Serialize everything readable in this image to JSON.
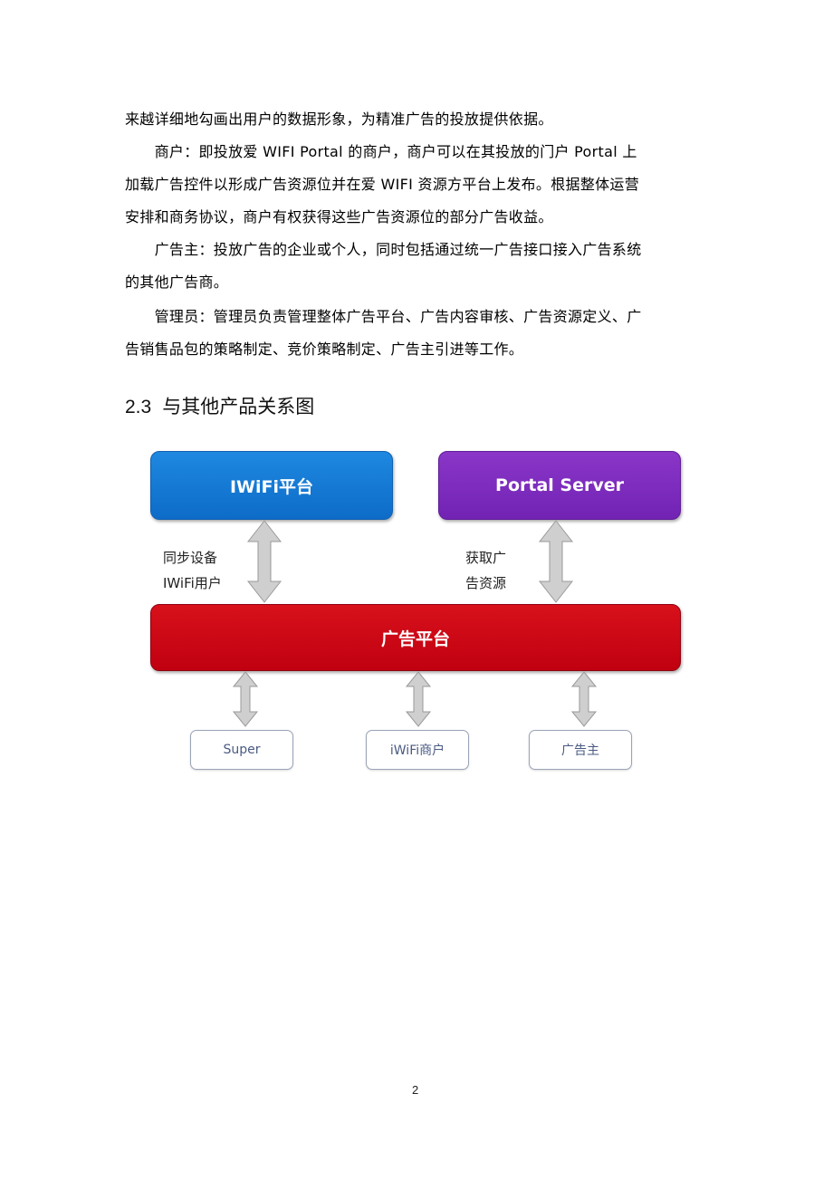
{
  "paragraphs": [
    "来越详细地勾画出用户的数据形象，为精准广告的投放提供依据。",
    "　　商户：即投放爱  WIFI Portal    的商户，商户可以在其投放的门户     Portal  上",
    "加载广告控件以形成广告资源位并在爱     WIFI 资源方平台上发布。根据整体运营",
    "安排和商务协议，商户有权获得这些广告资源位的部分广告收益。",
    "　　广告主：投放广告的企业或个人，同时包括通过统一广告接口接入广告系统",
    "的其他广告商。",
    "　　管理员：管理员负责管理整体广告平台、广告内容审核、广告资源定义、广",
    "告销售品包的策略制定、竞价策略制定、广告主引进等工作。"
  ],
  "section": {
    "number": "2.3",
    "title": "与其他产品关系图"
  },
  "diagram": {
    "top_boxes": [
      {
        "label": "IWiFi平台",
        "color": "#1a7fdc"
      },
      {
        "label": "Portal Server",
        "color": "#7f2dbf"
      }
    ],
    "center_box": {
      "label": "广告平台",
      "color": "#cc0a16"
    },
    "arrow_labels": [
      {
        "line1": "同步设备",
        "line2": "IWiFi用户"
      },
      {
        "line1": "获取广",
        "line2": "告资源"
      }
    ],
    "bottom_boxes": [
      {
        "label": "Super"
      },
      {
        "label": "iWiFi商户"
      },
      {
        "label": "广告主"
      }
    ],
    "arrow_color": "#c8c8c8"
  },
  "page_number": "2"
}
